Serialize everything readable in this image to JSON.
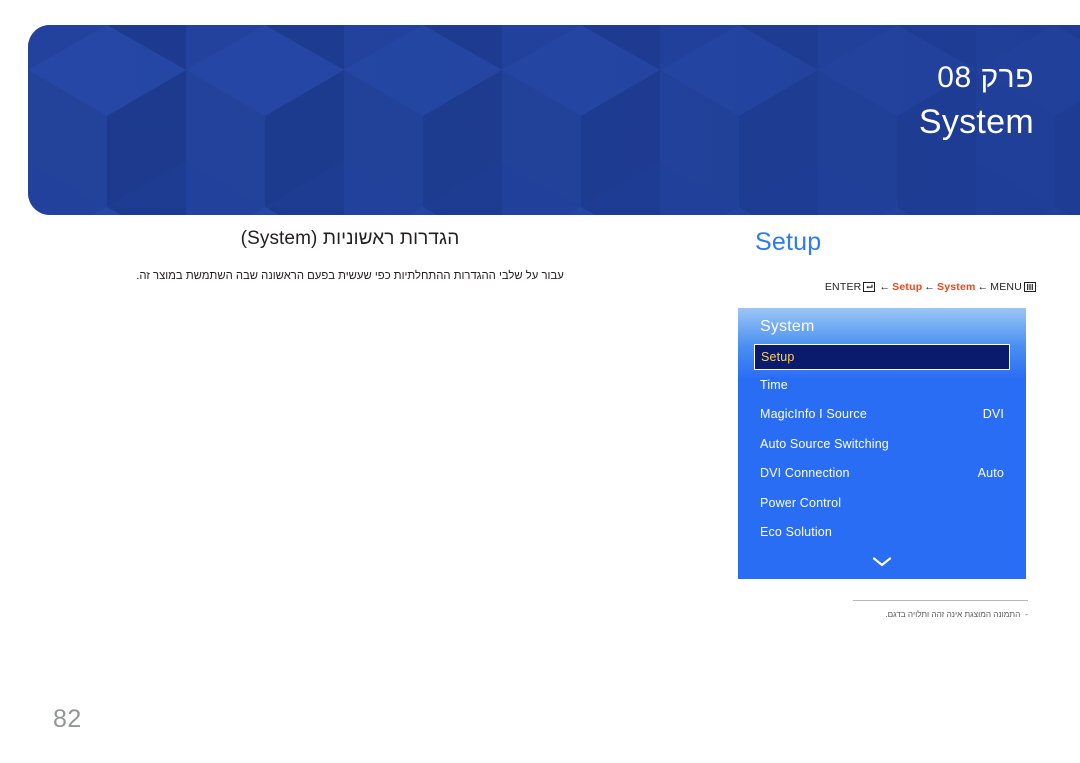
{
  "banner": {
    "chapter": "פרק 08",
    "title": "System",
    "bg_color": "#1e3d96"
  },
  "left": {
    "section_title": "הגדרות ראשוניות (System)",
    "body_text": "עבור על שלבי ההגדרות ההתחלתיות כפי שעשית בפעם הראשונה שבה השתמשת במוצר זה."
  },
  "right": {
    "heading": "Setup",
    "heading_color": "#2d7bf4",
    "breadcrumb": {
      "enter_label": "ENTER",
      "enter_icon": "enter-key-icon",
      "arrow": "←",
      "setup_label": "Setup",
      "system_label": "System",
      "menu_label": "MENU",
      "menu_icon": "menu-grid-icon",
      "accent_color": "#e8471e"
    }
  },
  "osd": {
    "title": "System",
    "highlight_text_color": "#ffd24a",
    "highlight_bg_color": "#0a1b6e",
    "panel_color": "#2a6df5",
    "items": [
      {
        "label": "Setup",
        "value": "",
        "selected": true
      },
      {
        "label": "Time",
        "value": "",
        "selected": false
      },
      {
        "label": "MagicInfo I Source",
        "value": "DVI",
        "selected": false
      },
      {
        "label": "Auto Source Switching",
        "value": "",
        "selected": false
      },
      {
        "label": "DVI Connection",
        "value": "Auto",
        "selected": false
      },
      {
        "label": "Power Control",
        "value": "",
        "selected": false
      },
      {
        "label": "Eco Solution",
        "value": "",
        "selected": false
      }
    ],
    "scroll_icon": "chevron-down-icon"
  },
  "footnote": {
    "dash": "-",
    "text": "התמונה המוצגת אינה זהה ותלויה בדגם."
  },
  "page": {
    "number": "82"
  }
}
